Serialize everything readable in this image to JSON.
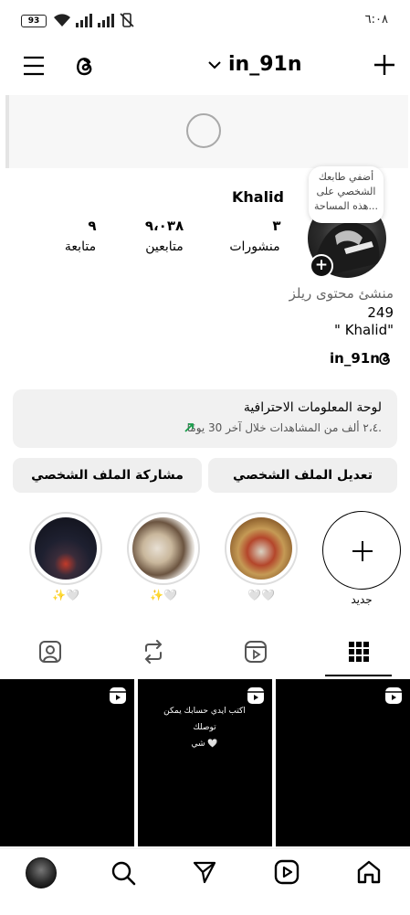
{
  "status_bar": {
    "battery": "93",
    "time": "٦:٠٨"
  },
  "header": {
    "username": "in_91n"
  },
  "profile": {
    "note_text": "أضفي طابعك الشخصي على هذه المساحة...",
    "display_name": "Khalid",
    "stats": [
      {
        "value": "٣",
        "label": "منشورات"
      },
      {
        "value": "٩،٠٣٨",
        "label": "متابعين"
      },
      {
        "value": "٩",
        "label": "متابعة"
      }
    ],
    "category": "منشئ محتوى ريلز",
    "bio_line1": "249",
    "bio_line2": "\" Khalid\"",
    "threads_handle": "in_91n"
  },
  "dashboard": {
    "title": "لوحة المعلومات الاحترافية",
    "subtitle": "٢،٤ ألف من المشاهدات خلال آخر 30 يومًا."
  },
  "buttons": {
    "edit_profile": "تعديل الملف الشخصي",
    "share_profile": "مشاركة الملف الشخصي"
  },
  "highlights": [
    {
      "label": "جديد",
      "icon": "plus-icon"
    },
    {
      "label": "🤍🤍"
    },
    {
      "label": "✨🤍"
    },
    {
      "label": "✨🤍"
    }
  ],
  "posts": [
    {
      "overlay_text": "",
      "caption": "",
      "icon": "reel-icon"
    },
    {
      "overlay_text": "اكتب ايدي حسابك يمكن توصلك",
      "overlay_text2": "شي 🤍",
      "icon": "reel-icon"
    },
    {
      "overlay_text": "",
      "caption": "",
      "icon": "reel-icon"
    }
  ],
  "colors": {
    "dashboard_arrow": "#1a9c4b",
    "tab_active": "#000000"
  }
}
